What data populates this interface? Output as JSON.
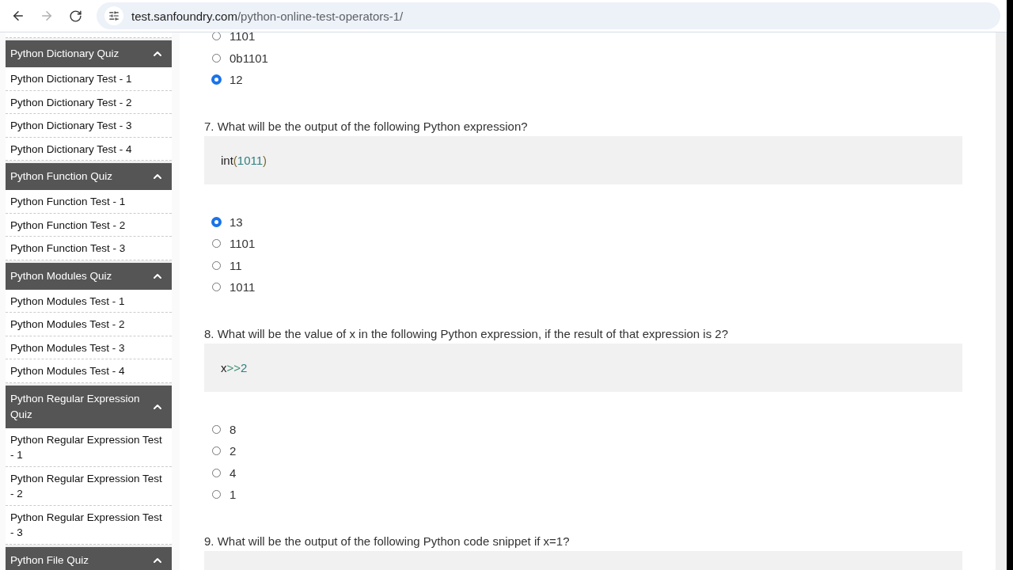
{
  "browser": {
    "back_disabled": false,
    "forward_disabled": true,
    "url": {
      "host": "test.sanfoundry.com",
      "path": "/python-online-test-operators-1/"
    }
  },
  "sidebar": {
    "groups": [
      {
        "title": "Python Dictionary Quiz",
        "expanded": true,
        "items": [
          "Python Dictionary Test - 1",
          "Python Dictionary Test - 2",
          "Python Dictionary Test - 3",
          "Python Dictionary Test - 4"
        ]
      },
      {
        "title": "Python Function Quiz",
        "expanded": true,
        "items": [
          "Python Function Test - 1",
          "Python Function Test - 2",
          "Python Function Test - 3"
        ]
      },
      {
        "title": "Python Modules Quiz",
        "expanded": true,
        "items": [
          "Python Modules Test - 1",
          "Python Modules Test - 2",
          "Python Modules Test - 3",
          "Python Modules Test - 4"
        ]
      },
      {
        "title": "Python Regular Expression Quiz",
        "expanded": true,
        "items": [
          "Python Regular Expression Test - 1",
          "Python Regular Expression Test - 2",
          "Python Regular Expression Test - 3"
        ]
      },
      {
        "title": "Python File Quiz",
        "expanded": true
      }
    ]
  },
  "questions": [
    {
      "options": [
        {
          "label": "1101",
          "selected": false
        },
        {
          "label": "0b1101",
          "selected": false
        },
        {
          "label": "12",
          "selected": true
        }
      ]
    },
    {
      "text": "7. What will be the output of the following Python expression?",
      "code": [
        {
          "text": "int",
          "kind": "name"
        },
        {
          "text": "(",
          "kind": "paren"
        },
        {
          "text": "1011",
          "kind": "number"
        },
        {
          "text": ")",
          "kind": "paren"
        }
      ],
      "options": [
        {
          "label": "13",
          "selected": true
        },
        {
          "label": "1101",
          "selected": false
        },
        {
          "label": "11",
          "selected": false
        },
        {
          "label": "1011",
          "selected": false
        }
      ]
    },
    {
      "text": "8. What will be the value of x in the following Python expression, if the result of that expression is 2?",
      "code": [
        {
          "text": "x",
          "kind": "name"
        },
        {
          "text": ">>",
          "kind": "operator"
        },
        {
          "text": "2",
          "kind": "number"
        }
      ],
      "options": [
        {
          "label": "8",
          "selected": false
        },
        {
          "label": "2",
          "selected": false
        },
        {
          "label": "4",
          "selected": false
        },
        {
          "label": "1",
          "selected": false
        }
      ]
    },
    {
      "text": "9. What will be the output of the following Python code snippet if x=1?"
    }
  ]
}
